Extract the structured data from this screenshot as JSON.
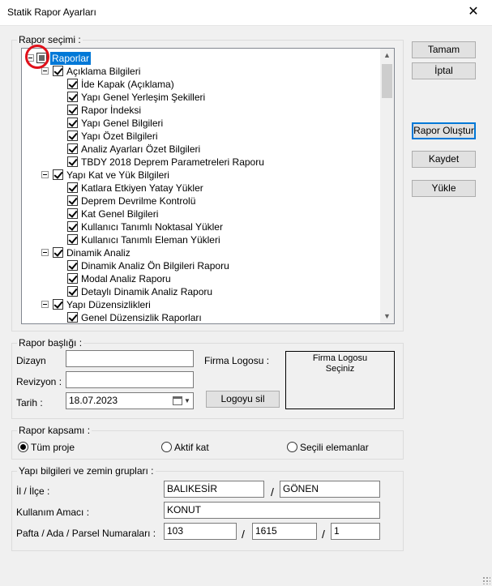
{
  "window": {
    "title": "Statik Rapor Ayarları",
    "close_label": "✕"
  },
  "buttons": {
    "ok": "Tamam",
    "cancel": "İptal",
    "create_report": "Rapor Oluştur",
    "save": "Kaydet",
    "load": "Yükle",
    "delete_logo": "Logoyu sil"
  },
  "report_selection": {
    "group_label": "Rapor seçimi :",
    "tree": [
      {
        "label": "Raporlar",
        "level": 0,
        "checked": "partial",
        "expander": true,
        "selected": true
      },
      {
        "label": "Açıklama Bilgileri",
        "level": 1,
        "checked": "checked",
        "expander": true
      },
      {
        "label": "İde Kapak (Açıklama)",
        "level": 2,
        "checked": "checked"
      },
      {
        "label": "Yapı Genel Yerleşim Şekilleri",
        "level": 2,
        "checked": "checked"
      },
      {
        "label": "Rapor İndeksi",
        "level": 2,
        "checked": "checked"
      },
      {
        "label": "Yapı Genel Bilgileri",
        "level": 2,
        "checked": "checked"
      },
      {
        "label": "Yapı Özet Bilgileri",
        "level": 2,
        "checked": "checked"
      },
      {
        "label": "Analiz Ayarları Özet Bilgileri",
        "level": 2,
        "checked": "checked"
      },
      {
        "label": "TBDY 2018 Deprem Parametreleri Raporu",
        "level": 2,
        "checked": "checked"
      },
      {
        "label": "Yapı Kat ve Yük Bilgileri",
        "level": 1,
        "checked": "checked",
        "expander": true
      },
      {
        "label": "Katlara Etkiyen Yatay Yükler",
        "level": 2,
        "checked": "checked"
      },
      {
        "label": "Deprem Devrilme Kontrolü",
        "level": 2,
        "checked": "checked"
      },
      {
        "label": "Kat Genel Bilgileri",
        "level": 2,
        "checked": "checked"
      },
      {
        "label": "Kullanıcı Tanımlı Noktasal Yükler",
        "level": 2,
        "checked": "checked"
      },
      {
        "label": "Kullanıcı Tanımlı Eleman Yükleri",
        "level": 2,
        "checked": "checked"
      },
      {
        "label": "Dinamik Analiz",
        "level": 1,
        "checked": "checked",
        "expander": true
      },
      {
        "label": "Dinamik Analiz Ön Bilgileri Raporu",
        "level": 2,
        "checked": "checked"
      },
      {
        "label": "Modal Analiz Raporu",
        "level": 2,
        "checked": "checked"
      },
      {
        "label": "Detaylı Dinamik Analiz Raporu",
        "level": 2,
        "checked": "checked"
      },
      {
        "label": "Yapı Düzensizlikleri",
        "level": 1,
        "checked": "checked",
        "expander": true
      },
      {
        "label": "Genel Düzensizlik Raporları",
        "level": 2,
        "checked": "checked"
      }
    ]
  },
  "report_header": {
    "group_label": "Rapor başlığı :",
    "designer_label": "Dizayn",
    "designer_value": "",
    "revision_label": "Revizyon :",
    "revision_value": "",
    "date_label": "Tarih :",
    "date_value": "18.07.2023",
    "logo_label": "Firma Logosu :",
    "logo_box_line1": "Firma Logosu",
    "logo_box_line2": "Seçiniz"
  },
  "report_scope": {
    "group_label": "Rapor kapsamı :",
    "options": [
      {
        "label": "Tüm proje",
        "selected": true
      },
      {
        "label": "Aktif kat",
        "selected": false
      },
      {
        "label": "Seçili elemanlar",
        "selected": false
      }
    ]
  },
  "building_info": {
    "group_label": "Yapı bilgileri ve zemin grupları :",
    "province_label": "İl / İlçe :",
    "province_value": "BALIKESİR",
    "district_value": "GÖNEN",
    "usage_label": "Kullanım Amacı :",
    "usage_value": "KONUT",
    "parcel_label": "Pafta / Ada / Parsel Numaraları :",
    "pafta_value": "103",
    "ada_value": "1615",
    "parsel_value": "1",
    "separator": "/"
  },
  "colors": {
    "selection": "#0078d7",
    "highlight_circle": "#e0101a"
  }
}
